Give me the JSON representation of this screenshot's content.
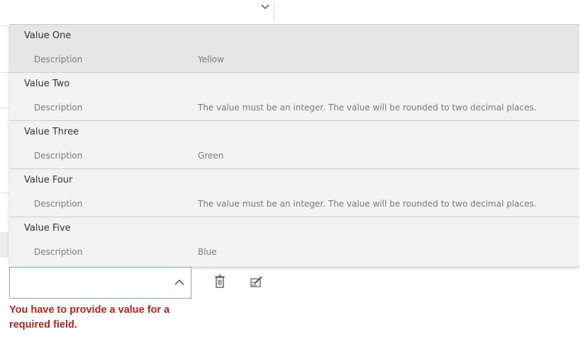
{
  "options": [
    {
      "title": "Value One",
      "desc_label": "Description",
      "desc_value": "Yellow"
    },
    {
      "title": "Value Two",
      "desc_label": "Description",
      "desc_value": "The value must be an integer. The value will be rounded to two decimal places."
    },
    {
      "title": "Value Three",
      "desc_label": "Description",
      "desc_value": "Green"
    },
    {
      "title": "Value Four",
      "desc_label": "Description",
      "desc_value": "The value must be an integer. The value will be rounded to two decimal places."
    },
    {
      "title": "Value Five",
      "desc_label": "Description",
      "desc_value": "Blue"
    }
  ],
  "combo": {
    "value": ""
  },
  "error": {
    "message": "You have to provide a value for a required field."
  },
  "icons": {
    "combo_toggle": "chevron-up-icon",
    "delete": "trash-icon",
    "edit": "edit-icon",
    "background_toggle": "chevron-down-icon"
  },
  "colors": {
    "error": "#b3261e",
    "focus_border": "#7aa7d6",
    "list_background": "#f2f2f2"
  }
}
